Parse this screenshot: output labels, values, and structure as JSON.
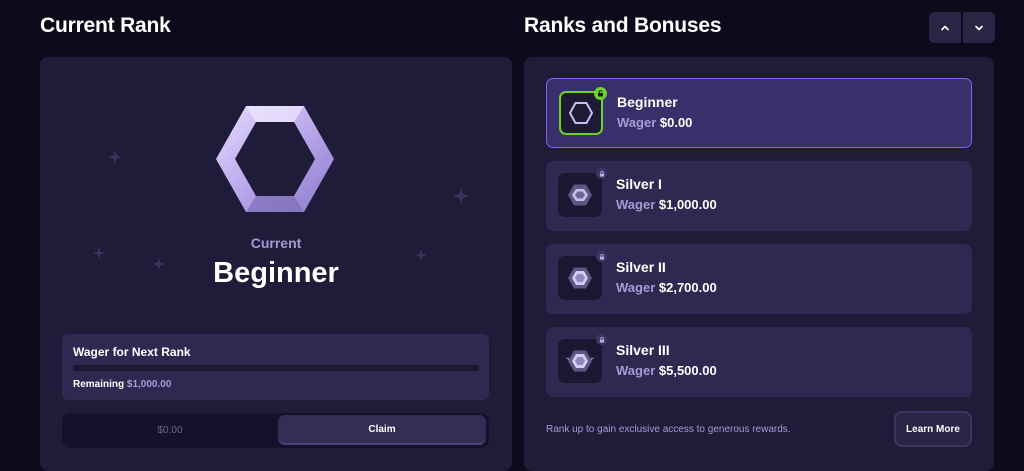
{
  "left": {
    "title": "Current Rank",
    "current_label": "Current",
    "current_rank": "Beginner",
    "wager_title": "Wager for Next Rank",
    "remaining_label": "Remaining",
    "remaining_value": "$1,000.00",
    "progress_fraction": 0.0,
    "claim_amount": "$0.00",
    "claim_label": "Claim"
  },
  "right": {
    "title": "Ranks and Bonuses",
    "scroll_up_icon": "chevron-up-icon",
    "scroll_down_icon": "chevron-down-icon",
    "wager_label": "Wager",
    "ranks": [
      {
        "name": "Beginner",
        "wager": "$0.00",
        "status": "unlocked",
        "icon": "hexagon-rank-icon"
      },
      {
        "name": "Silver I",
        "wager": "$1,000.00",
        "status": "locked",
        "icon": "silver-rank-icon"
      },
      {
        "name": "Silver II",
        "wager": "$2,700.00",
        "status": "locked",
        "icon": "silver-rank-icon"
      },
      {
        "name": "Silver III",
        "wager": "$5,500.00",
        "status": "locked",
        "icon": "silver-rank-icon"
      }
    ],
    "footer_text": "Rank up to gain exclusive access to generous rewards.",
    "learn_more": "Learn More"
  },
  "colors": {
    "background": "#0c0b1c",
    "panel": "#1f1c39",
    "card": "#2e2950",
    "accent_purple": "#8b5cf6",
    "accent_green": "#6fd12a",
    "muted_text": "#a79bd6"
  }
}
